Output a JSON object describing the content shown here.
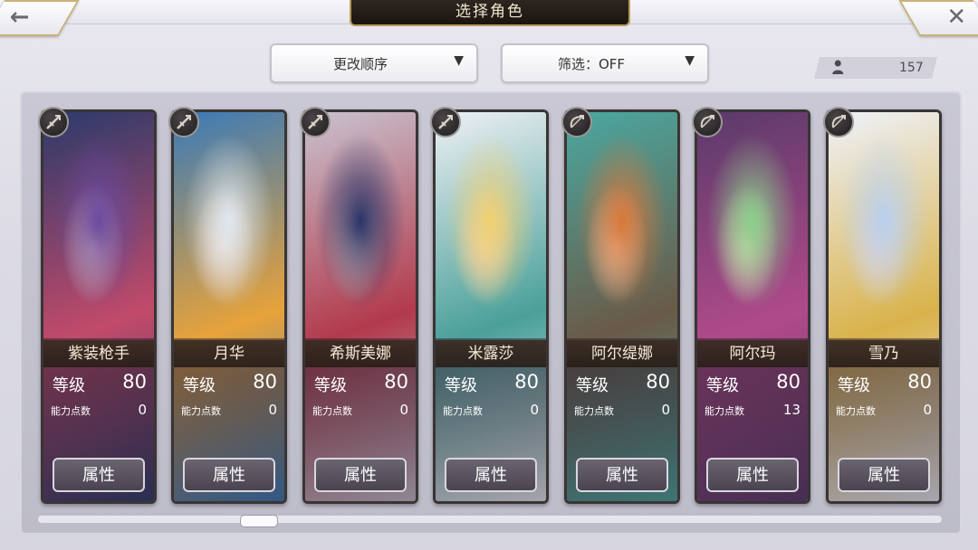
{
  "header": {
    "title": "选择角色",
    "back_icon": "back-arrow-icon",
    "close_icon": "close-icon"
  },
  "controls": {
    "sort_label": "更改顺序",
    "filter_label": "筛选：OFF",
    "character_count": "157"
  },
  "labels": {
    "level": "等级",
    "ability_points": "能力点数",
    "attribute_button": "属性"
  },
  "characters": [
    {
      "name": "紫装枪手",
      "level": "80",
      "ability_points": "0",
      "class_icon": "gun-class-icon",
      "colors": [
        "#6a4aa0",
        "#2b3a6a",
        "#c24a6a"
      ]
    },
    {
      "name": "月华",
      "level": "80",
      "ability_points": "0",
      "class_icon": "gun-class-icon",
      "colors": [
        "#dfe8f0",
        "#3a7ab8",
        "#e7a23a"
      ]
    },
    {
      "name": "希斯美娜",
      "level": "80",
      "ability_points": "0",
      "class_icon": "gun-class-icon",
      "colors": [
        "#2a3468",
        "#c9c3cf",
        "#b23a4c"
      ]
    },
    {
      "name": "米露莎",
      "level": "80",
      "ability_points": "0",
      "class_icon": "gun-class-icon",
      "colors": [
        "#f0d070",
        "#eef0f4",
        "#4aa09a"
      ]
    },
    {
      "name": "阿尔缇娜",
      "level": "80",
      "ability_points": "0",
      "class_icon": "bow-class-icon",
      "colors": [
        "#d9783a",
        "#4aa8a0",
        "#6a5a48"
      ]
    },
    {
      "name": "阿尔玛",
      "level": "80",
      "ability_points": "13",
      "class_icon": "bow-class-icon",
      "colors": [
        "#8acf8a",
        "#5a3a6a",
        "#b04a8a"
      ]
    },
    {
      "name": "雪乃",
      "level": "80",
      "ability_points": "0",
      "class_icon": "bow-class-icon",
      "colors": [
        "#b8d0ee",
        "#eef2fa",
        "#d9b24a"
      ]
    }
  ]
}
